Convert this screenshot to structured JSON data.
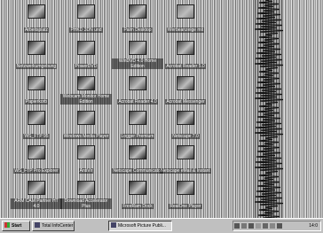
{
  "desktop": {
    "icons": [
      {
        "name": "my-computer-icon",
        "label": "Arbeitsplatz",
        "color": "#3a3a3a"
      },
      {
        "name": "network-icon",
        "label": "PHKD 3DN und",
        "color": "#505050"
      },
      {
        "name": "palm-desktop-icon",
        "label": "Palm Desktop",
        "color": "#3a3a3a"
      },
      {
        "name": "folder-icon",
        "label": "Werbeanzeige mit",
        "color": "#808080"
      },
      {
        "name": "network-neighborhood-icon",
        "label": "Netzwerkumgebung",
        "color": "#2e2e2e"
      },
      {
        "name": "powerdvd-icon",
        "label": "PowerDVD",
        "color": "#404040"
      },
      {
        "name": "winwav-icon",
        "label": "WinDVD 4.0 Home Edition",
        "color": "#505050"
      },
      {
        "name": "acrobat-reader-icon",
        "label": "Acrobat Reader 5.0",
        "color": "#404040"
      },
      {
        "name": "recycle-bin-icon",
        "label": "Papierkorb",
        "color": "#3a3a3a"
      },
      {
        "name": "webcam-icon",
        "label": "Webcam Monitor Home Edition",
        "color": "#202020"
      },
      {
        "name": "acrobat-reader-4-icon",
        "label": "Acrobat Reader 4.0",
        "color": "#505050"
      },
      {
        "name": "acrobat-messenger-icon",
        "label": "Acrobat Messenger",
        "color": "#404040"
      },
      {
        "name": "wsftp-icon",
        "label": "WS_FTP 95",
        "color": "#2e2e2e"
      },
      {
        "name": "windows-media-player-icon",
        "label": "Windows Media Player",
        "color": "#3a3a3a"
      },
      {
        "name": "alogger-icon",
        "label": "Logger Premium",
        "color": "#404040"
      },
      {
        "name": "netscape-icon",
        "label": "Netscape 7.0",
        "color": "#303030"
      },
      {
        "name": "ftp-explorer-icon",
        "label": "WS_FTP Pro Explorer",
        "color": "#303030"
      },
      {
        "name": "antivirus-icon",
        "label": "AntiVir",
        "color": "#505050"
      },
      {
        "name": "netscape-communicator-icon",
        "label": "Netscape Communicator",
        "color": "#202020"
      },
      {
        "name": "netscape-mail-icon",
        "label": "Netscape eMail & Instant",
        "color": "#404040"
      },
      {
        "name": "arm-cam-icon",
        "label": "ARM CAM Partner HT 4.0",
        "color": "#303030"
      },
      {
        "name": "download-accelerator-icon",
        "label": "Download Accelerator Plus",
        "color": "#404040"
      },
      {
        "name": "freeram-icon",
        "label": "FreeRam Dock",
        "color": "#303030"
      },
      {
        "name": "realone-icon",
        "label": "RealOne Player",
        "color": "#3a3a3a"
      }
    ]
  },
  "taskbar": {
    "start_label": "Start",
    "tasks": [
      {
        "label": "Total InfoCenter",
        "pressed": false
      },
      {
        "label": "Microsoft Picture Publi...",
        "pressed": true
      }
    ],
    "clock": "14:0"
  },
  "colors": {
    "taskbar": "#c0c0c0",
    "desktop_stripe_light": "#e6e6e6",
    "desktop_stripe_dark": "#6d6d6d"
  }
}
